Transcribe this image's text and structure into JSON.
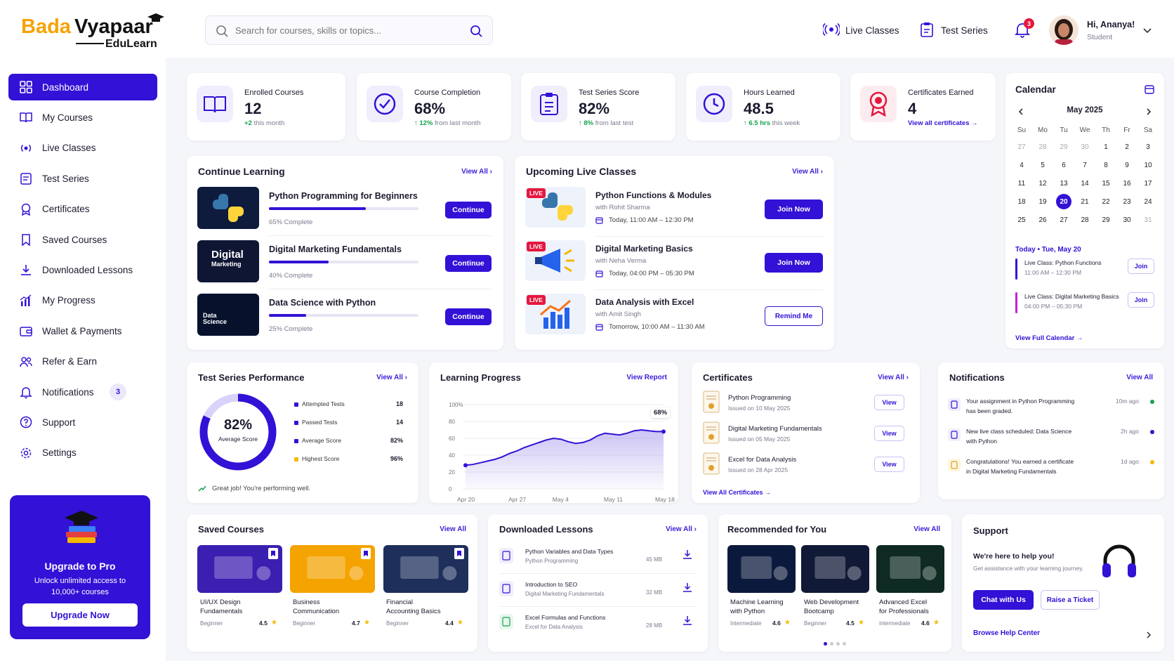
{
  "brand": {
    "name1": "Bada",
    "name2": "Vyapaar",
    "sub": "EduLearn"
  },
  "search": {
    "placeholder": "Search for courses, skills or topics..."
  },
  "header": {
    "live": "Live Classes",
    "tests": "Test Series",
    "notif_count": "3",
    "greeting": "Hi, Ananya!",
    "role": "Student"
  },
  "sidebar": {
    "items": [
      {
        "label": "Dashboard",
        "icon": "dashboard-icon"
      },
      {
        "label": "My Courses",
        "icon": "book-icon"
      },
      {
        "label": "Live Classes",
        "icon": "broadcast-icon"
      },
      {
        "label": "Test Series",
        "icon": "clipboard-icon"
      },
      {
        "label": "Certificates",
        "icon": "award-icon"
      },
      {
        "label": "Saved Courses",
        "icon": "bookmark-icon"
      },
      {
        "label": "Downloaded Lessons",
        "icon": "download-icon"
      },
      {
        "label": "My Progress",
        "icon": "chart-icon"
      },
      {
        "label": "Wallet & Payments",
        "icon": "wallet-icon"
      },
      {
        "label": "Refer & Earn",
        "icon": "users-icon"
      },
      {
        "label": "Notifications",
        "icon": "bell-icon",
        "badge": "3"
      },
      {
        "label": "Support",
        "icon": "help-icon"
      },
      {
        "label": "Settings",
        "icon": "gear-icon"
      }
    ]
  },
  "upgrade": {
    "title": "Upgrade to Pro",
    "text1": "Unlock unlimited access to",
    "text2": "10,000+ courses",
    "button": "Upgrade Now"
  },
  "stats": [
    {
      "label": "Enrolled Courses",
      "value": "12",
      "delta": "+2",
      "sub": " this month"
    },
    {
      "label": "Course Completion",
      "value": "68%",
      "delta": "↑ 12%",
      "sub": " from last month"
    },
    {
      "label": "Test Series Score",
      "value": "82%",
      "delta": "↑ 8%",
      "sub": " from last test"
    },
    {
      "label": "Hours Learned",
      "value": "48.5",
      "delta": "↑ 6.5 hrs",
      "sub": " this week"
    },
    {
      "label": "Certificates Earned",
      "value": "4",
      "link": "View all certificates →"
    }
  ],
  "continue": {
    "title": "Continue Learning",
    "view": "View All ›",
    "button": "Continue",
    "items": [
      {
        "title": "Python Programming for Beginners",
        "progress": 65,
        "status": "65% Complete"
      },
      {
        "title": "Digital Marketing Fundamentals",
        "progress": 40,
        "status": "40% Complete",
        "thumb1": "Digital",
        "thumb2": "Marketing"
      },
      {
        "title": "Data Science with Python",
        "progress": 25,
        "status": "25% Complete",
        "thumb1": "Data",
        "thumb2": "Science"
      }
    ]
  },
  "live": {
    "title": "Upcoming Live Classes",
    "view": "View All ›",
    "badge": "LIVE",
    "items": [
      {
        "title": "Python Functions & Modules",
        "teacher": "with Rohit Sharma",
        "time": "Today, 11:00 AM – 12:30 PM",
        "button": "Join Now"
      },
      {
        "title": "Digital Marketing Basics",
        "teacher": "with Neha Verma",
        "time": "Today, 04:00 PM – 05:30 PM",
        "button": "Join Now"
      },
      {
        "title": "Data Analysis with Excel",
        "teacher": "with Amit Singh",
        "time": "Tomorrow, 10:00 AM – 11:30 AM",
        "button": "Remind Me"
      }
    ]
  },
  "calendar": {
    "title": "Calendar",
    "month": "May 2025",
    "days": [
      "Su",
      "Mo",
      "Tu",
      "We",
      "Th",
      "Fr",
      "Sa"
    ],
    "weeks": [
      [
        "27",
        "28",
        "29",
        "30",
        "1",
        "2",
        "3"
      ],
      [
        "4",
        "5",
        "6",
        "7",
        "8",
        "9",
        "10"
      ],
      [
        "11",
        "12",
        "13",
        "14",
        "15",
        "16",
        "17"
      ],
      [
        "18",
        "19",
        "20",
        "21",
        "22",
        "23",
        "24"
      ],
      [
        "25",
        "26",
        "27",
        "28",
        "29",
        "30",
        "31"
      ]
    ],
    "today_label": "Today • Tue, May 20",
    "events": [
      {
        "title": "Live Class: Python Functions",
        "time": "11:00 AM – 12:30 PM",
        "button": "Join",
        "color": "#3311d6"
      },
      {
        "title": "Live Class: Digital Marketing Basics",
        "time": "04:00 PM – 05:30 PM",
        "button": "Join",
        "color": "#c026d3"
      }
    ],
    "full": "View Full Calendar →"
  },
  "tests": {
    "title": "Test Series Performance",
    "view": "View All ›",
    "score": "82%",
    "score_value": 82,
    "score_label": "Average Score",
    "rows": [
      {
        "label": "Attempted Tests",
        "value": "18",
        "color": "#3311d6"
      },
      {
        "label": "Passed Tests",
        "value": "14",
        "color": "#3311d6"
      },
      {
        "label": "Average Score",
        "value": "82%",
        "color": "#3311d6"
      },
      {
        "label": "Highest Score",
        "value": "96%",
        "color": "#f5b800"
      }
    ],
    "footer": "Great job! You're performing well."
  },
  "progress": {
    "title": "Learning Progress",
    "view": "View Report",
    "badge": "68%"
  },
  "chart_data": {
    "type": "area",
    "title": "Learning Progress",
    "x": [
      "Apr 20",
      "Apr 21",
      "Apr 22",
      "Apr 23",
      "Apr 24",
      "Apr 25",
      "Apr 26",
      "Apr 27",
      "Apr 28",
      "Apr 29",
      "May 1",
      "May 2",
      "May 3",
      "May 4",
      "May 5",
      "May 6",
      "May 7",
      "May 8",
      "May 9",
      "May 10",
      "May 11",
      "May 12",
      "May 13",
      "May 14",
      "May 15",
      "May 16",
      "May 17",
      "May 18"
    ],
    "series": [
      {
        "values": [
          28,
          29,
          31,
          33,
          35,
          38,
          42,
          45,
          49,
          52,
          55,
          58,
          60,
          59,
          56,
          54,
          55,
          58,
          63,
          66,
          65,
          64,
          66,
          69,
          70,
          69,
          68,
          68
        ]
      }
    ],
    "xticks": [
      "Apr 20",
      "Apr 27",
      "May 4",
      "May 11",
      "May 18"
    ],
    "yticks": [
      "0",
      "20",
      "40",
      "60",
      "80",
      "100%"
    ],
    "ylim": [
      0,
      100
    ]
  },
  "certs": {
    "title": "Certificates",
    "view": "View All ›",
    "button": "View",
    "items": [
      {
        "title": "Python Programming",
        "date": "Issued on 10 May 2025"
      },
      {
        "title": "Digital Marketing Fundamentals",
        "date": "Issued on 05 May 2025"
      },
      {
        "title": "Excel for Data Analysis",
        "date": "Issued on 28 Apr 2025"
      }
    ],
    "footer": "View All Certificates →"
  },
  "notifications": {
    "title": "Notifications",
    "view": "View All",
    "items": [
      {
        "line1": "Your assignment in Python Programming",
        "line2": "has been graded.",
        "time": "10m ago",
        "color": "#14a44d"
      },
      {
        "line1": "New live class scheduled: Data Science",
        "line2": "with Python",
        "time": "2h ago",
        "color": "#3311d6"
      },
      {
        "line1": "Congratulations! You earned a certificate",
        "line2": "in Digital Marketing Fundamentals",
        "time": "1d ago",
        "color": "#f5b800"
      }
    ]
  },
  "saved": {
    "title": "Saved Courses",
    "view": "View All",
    "items": [
      {
        "t1": "UI/UX Design",
        "t2": "Fundamentals",
        "level": "Beginner",
        "rating": "4.5"
      },
      {
        "t1": "Business",
        "t2": "Communication",
        "level": "Beginner",
        "rating": "4.7"
      },
      {
        "t1": "Financial",
        "t2": "Accounting Basics",
        "level": "Beginner",
        "rating": "4.4"
      }
    ]
  },
  "downloads": {
    "title": "Downloaded Lessons",
    "view": "View All ›",
    "items": [
      {
        "title": "Python Variables and Data Types",
        "course": "Python Programming",
        "size": "45 MB"
      },
      {
        "title": "Introduction to SEO",
        "course": "Digital Marketing Fundamentals",
        "size": "32 MB"
      },
      {
        "title": "Excel Formulas and Functions",
        "course": "Excel for Data Analysis",
        "size": "28 MB"
      }
    ]
  },
  "recommended": {
    "title": "Recommended for You",
    "view": "View All",
    "items": [
      {
        "t1": "Machine Learning",
        "t2": "with Python",
        "level": "Intermediate",
        "rating": "4.6"
      },
      {
        "t1": "Web Development",
        "t2": "Bootcamp",
        "level": "Beginner",
        "rating": "4.5"
      },
      {
        "t1": "Advanced Excel",
        "t2": "for Professionals",
        "level": "Intermediate",
        "rating": "4.6"
      }
    ]
  },
  "support": {
    "title": "Support",
    "heading": "We're here to help you!",
    "text": "Get assistance with your learning journey.",
    "chat": "Chat with Us",
    "ticket": "Raise a Ticket",
    "browse": "Browse Help Center"
  }
}
